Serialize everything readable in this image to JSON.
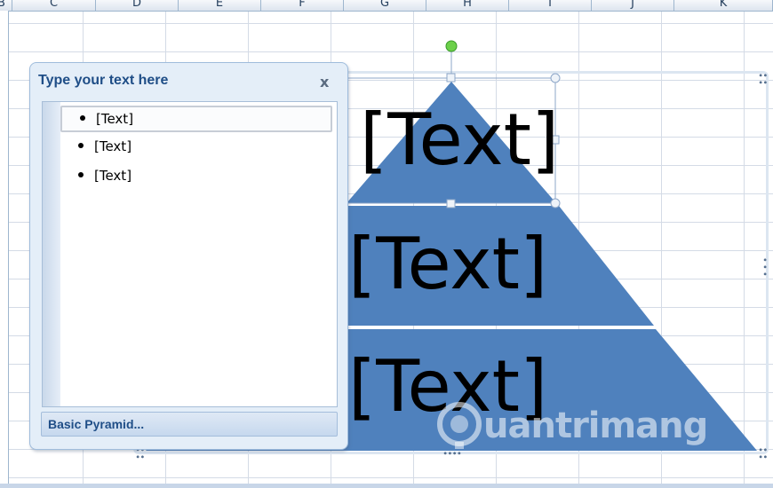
{
  "spreadsheet": {
    "columns": [
      "B",
      "C",
      "D",
      "E",
      "F",
      "G",
      "H",
      "I",
      "J",
      "K"
    ]
  },
  "text_pane": {
    "title": "Type your text here",
    "close_glyph": "x",
    "items": [
      "[Text]",
      "[Text]",
      "[Text]"
    ],
    "footer_label": "Basic Pyramid..."
  },
  "pyramid": {
    "fill_color": "#4f81bd",
    "levels": [
      "[Text]",
      "[Text]",
      "[Text]"
    ]
  },
  "watermark": {
    "text": "uantrimang"
  }
}
